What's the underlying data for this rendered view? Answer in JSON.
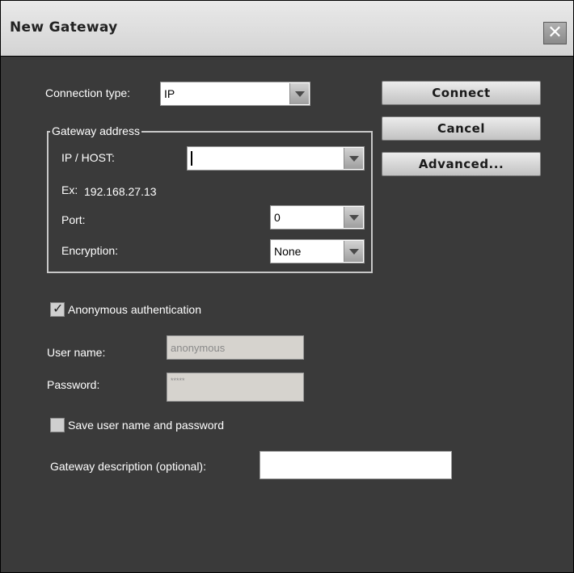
{
  "window": {
    "title": "New Gateway",
    "close_glyph": "✕"
  },
  "connection": {
    "label": "Connection type:",
    "value": "IP"
  },
  "gateway_address": {
    "legend": "Gateway address",
    "ip_label": "IP / HOST:",
    "ip_value": "",
    "example_label": "Ex:",
    "example_value": "192.168.27.13",
    "port_label": "Port:",
    "port_value": "0",
    "encryption_label": "Encryption:",
    "encryption_value": "None"
  },
  "buttons": {
    "connect": "Connect",
    "cancel": "Cancel",
    "advanced": "Advanced..."
  },
  "auth": {
    "anonymous_label": "Anonymous authentication",
    "anonymous_checked": true,
    "username_label": "User name:",
    "username_value": "anonymous",
    "password_label": "Password:",
    "password_value": "*****",
    "save_label": "Save user name and password",
    "save_checked": false
  },
  "description": {
    "label": "Gateway description (optional):",
    "value": ""
  },
  "icons": {
    "close": "close-icon",
    "check": "checkmark-icon",
    "dropdown": "chevron-down-icon"
  },
  "colors": {
    "panel": "#3a3a3a",
    "titlebar": "#dcdcdc",
    "button": "#d8d8d8",
    "disabled_field": "#d6d3ce"
  }
}
